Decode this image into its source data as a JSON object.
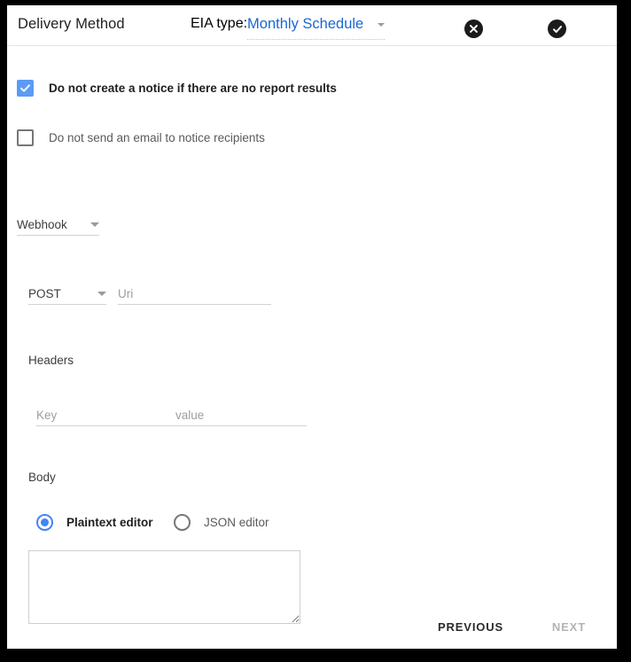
{
  "header": {
    "title": "Delivery Method",
    "eia_type_label": "EIA type:",
    "eia_type_value": "Monthly Schedule",
    "cancel_icon": "cancel-circle-icon",
    "confirm_icon": "check-circle-icon",
    "link_color": "#1967d2"
  },
  "options": {
    "no_notice": {
      "label": "Do not create a notice if there are no report results",
      "checked": true
    },
    "no_email": {
      "label": "Do not send an email to notice recipients",
      "checked": false
    },
    "accent_color": "#4285f4"
  },
  "channel": {
    "value": "Webhook",
    "caret_icon": "chevron-down-icon"
  },
  "request": {
    "method": "POST",
    "uri_placeholder": "Uri",
    "uri_value": "",
    "caret_icon": "chevron-down-icon"
  },
  "headers": {
    "label": "Headers",
    "key_placeholder": "Key",
    "key_value": "",
    "value_placeholder": "value",
    "value_value": ""
  },
  "body": {
    "label": "Body",
    "editor_options": [
      {
        "label": "Plaintext editor",
        "selected": true
      },
      {
        "label": "JSON editor",
        "selected": false
      }
    ],
    "content": "",
    "content_placeholder": ""
  },
  "footer": {
    "previous_label": "PREVIOUS",
    "next_label": "NEXT",
    "next_disabled": true
  }
}
